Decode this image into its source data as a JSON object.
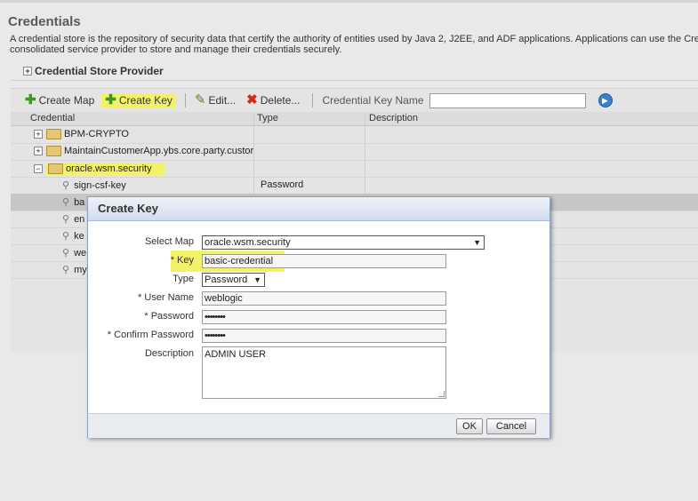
{
  "page": {
    "title": "Credentials",
    "description_line1": "A credential store is the repository of security data that certify the authority of entities used by Java 2, J2EE, and ADF applications. Applications can use the Cre",
    "description_line2": "consolidated service provider to store and manage their credentials securely.",
    "section_header": "Credential Store Provider"
  },
  "toolbar": {
    "create_map": "Create Map",
    "create_key": "Create Key",
    "edit": "Edit...",
    "delete": "Delete...",
    "search_label": "Credential Key Name",
    "search_value": ""
  },
  "table": {
    "columns": [
      "Credential",
      "Type",
      "Description"
    ],
    "rows": [
      {
        "kind": "map",
        "expanded": false,
        "name": "BPM-CRYPTO",
        "type": ""
      },
      {
        "kind": "map",
        "expanded": false,
        "name": "MaintainCustomerApp.ybs.core.party.custor",
        "type": ""
      },
      {
        "kind": "map",
        "expanded": true,
        "name": "oracle.wsm.security",
        "type": ""
      },
      {
        "kind": "key",
        "name": "sign-csf-key",
        "type": "Password"
      },
      {
        "kind": "key",
        "name": "ba",
        "type": ""
      },
      {
        "kind": "key",
        "name": "en",
        "type": ""
      },
      {
        "kind": "key",
        "name": "ke",
        "type": ""
      },
      {
        "kind": "key",
        "name": "we",
        "type": ""
      },
      {
        "kind": "key",
        "name": "my",
        "type": ""
      }
    ]
  },
  "dialog": {
    "title": "Create Key",
    "select_map_label": "Select Map",
    "select_map_value": "oracle.wsm.security",
    "key_label": "Key",
    "key_value": "basic-credential",
    "type_label": "Type",
    "type_value": "Password",
    "user_name_label": "User Name",
    "user_name_value": "weblogic",
    "password_label": "Password",
    "password_value": "••••••••",
    "confirm_password_label": "Confirm Password",
    "confirm_password_value": "••••••••",
    "description_label": "Description",
    "description_value": "ADMIN USER",
    "required_marker": "*",
    "ok_label": "OK",
    "cancel_label": "Cancel"
  },
  "colors": {
    "highlight": "#f2f26a",
    "dialog_header": "#cfdcee"
  }
}
